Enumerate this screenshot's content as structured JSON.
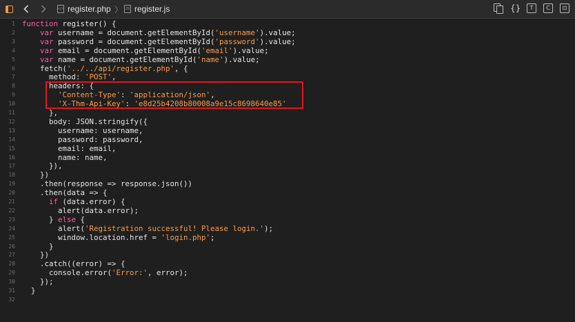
{
  "toolbar": {
    "back_icon": "chevron-left-icon",
    "forward_icon": "chevron-right-icon",
    "breadcrumbs": [
      {
        "label": "register.php",
        "icon": "php-file-icon"
      },
      {
        "label": "register.js",
        "icon": "js-file-icon"
      }
    ],
    "separator": "〉",
    "right_icons": [
      "documents-icon",
      "braces-icon",
      "text-icon",
      "comment-icon",
      "code-icon"
    ],
    "right_glyphs": [
      "",
      "{}",
      "T",
      "C",
      "⊡"
    ]
  },
  "colors": {
    "accent": "#f29b3b",
    "keyword": "#fc5fa3",
    "string": "#fc9d48",
    "highlight": "#e5161b"
  },
  "code": {
    "lines": [
      {
        "n": "1",
        "tokens": [
          [
            "kw",
            "function"
          ],
          [
            "pn",
            " register() {"
          ]
        ]
      },
      {
        "n": "2",
        "tokens": [
          [
            "pn",
            "    "
          ],
          [
            "kw",
            "var"
          ],
          [
            "pn",
            " username = document.getElementById("
          ],
          [
            "str",
            "'username'"
          ],
          [
            "pn",
            ").value;"
          ]
        ]
      },
      {
        "n": "3",
        "tokens": [
          [
            "pn",
            "    "
          ],
          [
            "kw",
            "var"
          ],
          [
            "pn",
            " password = document.getElementById("
          ],
          [
            "str",
            "'password'"
          ],
          [
            "pn",
            ").value;"
          ]
        ]
      },
      {
        "n": "4",
        "tokens": [
          [
            "pn",
            "    "
          ],
          [
            "kw",
            "var"
          ],
          [
            "pn",
            " email = document.getElementById("
          ],
          [
            "str",
            "'email'"
          ],
          [
            "pn",
            ").value;"
          ]
        ]
      },
      {
        "n": "5",
        "tokens": [
          [
            "pn",
            "    "
          ],
          [
            "kw",
            "var"
          ],
          [
            "pn",
            " name = document.getElementById("
          ],
          [
            "str",
            "'name'"
          ],
          [
            "pn",
            ").value;"
          ]
        ]
      },
      {
        "n": "6",
        "tokens": [
          [
            "pn",
            "    fetch("
          ],
          [
            "str",
            "'../../api/register.php'"
          ],
          [
            "pn",
            ", {"
          ]
        ]
      },
      {
        "n": "7",
        "tokens": [
          [
            "pn",
            "      method: "
          ],
          [
            "str",
            "'POST'"
          ],
          [
            "pn",
            ","
          ]
        ]
      },
      {
        "n": "8",
        "tokens": [
          [
            "pn",
            "      headers: {"
          ]
        ]
      },
      {
        "n": "9",
        "tokens": [
          [
            "pn",
            "        "
          ],
          [
            "str",
            "'Content-Type'"
          ],
          [
            "pn",
            ": "
          ],
          [
            "str",
            "'application/json'"
          ],
          [
            "pn",
            ","
          ]
        ]
      },
      {
        "n": "10",
        "tokens": [
          [
            "pn",
            "        "
          ],
          [
            "str",
            "'X-Thm-Api-Key'"
          ],
          [
            "pn",
            ": "
          ],
          [
            "str",
            "'e8d25b4208b80008a9e15c8698640e85'"
          ]
        ]
      },
      {
        "n": "11",
        "tokens": [
          [
            "pn",
            "      },"
          ]
        ]
      },
      {
        "n": "12",
        "tokens": [
          [
            "pn",
            "      body: JSON.stringify({"
          ]
        ]
      },
      {
        "n": "13",
        "tokens": [
          [
            "pn",
            "        username: username,"
          ]
        ]
      },
      {
        "n": "14",
        "tokens": [
          [
            "pn",
            "        password: password,"
          ]
        ]
      },
      {
        "n": "15",
        "tokens": [
          [
            "pn",
            "        email: email,"
          ]
        ]
      },
      {
        "n": "16",
        "tokens": [
          [
            "pn",
            "        name: name,"
          ]
        ]
      },
      {
        "n": "17",
        "tokens": [
          [
            "pn",
            "      }),"
          ]
        ]
      },
      {
        "n": "18",
        "tokens": [
          [
            "pn",
            "    })"
          ]
        ]
      },
      {
        "n": "19",
        "tokens": [
          [
            "pn",
            "    .then(response => response.json())"
          ]
        ]
      },
      {
        "n": "20",
        "tokens": [
          [
            "pn",
            "    .then(data => {"
          ]
        ]
      },
      {
        "n": "21",
        "tokens": [
          [
            "pn",
            "      "
          ],
          [
            "kw",
            "if"
          ],
          [
            "pn",
            " (data.error) {"
          ]
        ]
      },
      {
        "n": "22",
        "tokens": [
          [
            "pn",
            "        alert(data.error);"
          ]
        ]
      },
      {
        "n": "23",
        "tokens": [
          [
            "pn",
            "      } "
          ],
          [
            "kw",
            "else"
          ],
          [
            "pn",
            " {"
          ]
        ]
      },
      {
        "n": "24",
        "tokens": [
          [
            "pn",
            "        alert("
          ],
          [
            "str",
            "'Registration successful! Please login.'"
          ],
          [
            "pn",
            ");"
          ]
        ]
      },
      {
        "n": "25",
        "tokens": [
          [
            "pn",
            "        window.location.href = "
          ],
          [
            "str",
            "'login.php'"
          ],
          [
            "pn",
            ";"
          ]
        ]
      },
      {
        "n": "26",
        "tokens": [
          [
            "pn",
            "      }"
          ]
        ]
      },
      {
        "n": "27",
        "tokens": [
          [
            "pn",
            "    })"
          ]
        ]
      },
      {
        "n": "28",
        "tokens": [
          [
            "pn",
            "    .catch((error) => {"
          ]
        ]
      },
      {
        "n": "29",
        "tokens": [
          [
            "pn",
            "      console.error("
          ],
          [
            "str",
            "'Error:'"
          ],
          [
            "pn",
            ", error);"
          ]
        ]
      },
      {
        "n": "30",
        "tokens": [
          [
            "pn",
            "    });"
          ]
        ]
      },
      {
        "n": "31",
        "tokens": [
          [
            "pn",
            "  }"
          ]
        ]
      },
      {
        "n": "32",
        "tokens": []
      }
    ]
  }
}
